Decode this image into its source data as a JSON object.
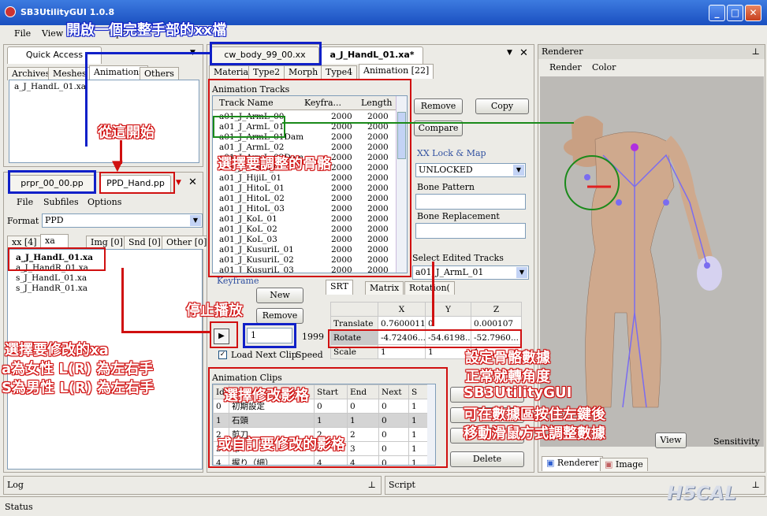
{
  "window": {
    "title": "SB3UtilityGUI 1.0.8",
    "min": "_",
    "max": "□",
    "close": "✕"
  },
  "menu": {
    "file": "File",
    "view": "View",
    "options": "Opti"
  },
  "quick": {
    "label": "Quick Access",
    "tabs": [
      "Archives",
      "Meshes",
      "Animations",
      "Others"
    ],
    "items": [
      "a_J_HandL_01.xa"
    ]
  },
  "pp": {
    "tabs": [
      "prpr_00_00.pp",
      "PPD_Hand.pp"
    ],
    "menu": [
      "File",
      "Subfiles",
      "Options"
    ],
    "format_label": "Format",
    "format_value": "PPD",
    "subtabs": [
      "xx [4]",
      "xa",
      "Img [0]",
      "Snd [0]",
      "Other [0]"
    ],
    "files": [
      "a_J_HandL_01.xa",
      "a_J_HandR_01.xa",
      "s_J_HandL_01.xa",
      "s_J_HandR_01.xa"
    ]
  },
  "editor": {
    "doctabs": [
      "cw_body_99_00.xx",
      "a_J_HandL_01.xa*"
    ],
    "subtabs": [
      "Material",
      "Type2",
      "Morph",
      "Type4",
      "Animation [22]"
    ]
  },
  "tracks": {
    "title": "Animation Tracks",
    "cols": [
      "Track Name",
      "Keyfra...",
      "Length"
    ],
    "rows": [
      [
        "a01_J_ArmL_00",
        "2000",
        "2000"
      ],
      [
        "a01_J_ArmL_01",
        "2000",
        "2000"
      ],
      [
        "a01_J_ArmL_01Dam",
        "2000",
        "2000"
      ],
      [
        "a01_J_ArmL_02",
        "2000",
        "2000"
      ],
      [
        "a01_J_ArmL_02Dam",
        "2000",
        "2000"
      ],
      [
        "a01_J_ArmL_02",
        "2000",
        "2000"
      ],
      [
        "a01_J_HijiL_01",
        "2000",
        "2000"
      ],
      [
        "a01_J_HitoL_01",
        "2000",
        "2000"
      ],
      [
        "a01_J_HitoL_02",
        "2000",
        "2000"
      ],
      [
        "a01_J_HitoL_03",
        "2000",
        "2000"
      ],
      [
        "a01_J_KoL_01",
        "2000",
        "2000"
      ],
      [
        "a01_J_KoL_02",
        "2000",
        "2000"
      ],
      [
        "a01_J_KoL_03",
        "2000",
        "2000"
      ],
      [
        "a01_J_KusuriL_01",
        "2000",
        "2000"
      ],
      [
        "a01_J_KusuriL_02",
        "2000",
        "2000"
      ],
      [
        "a01_J_KusuriL_03",
        "2000",
        "2000"
      ]
    ]
  },
  "right": {
    "remove": "Remove",
    "copy": "Copy",
    "compare": "Compare",
    "lock_title": "XX Lock & Map",
    "lock_value": "UNLOCKED",
    "bone_pattern": "Bone Pattern",
    "bone_replacement": "Bone Replacement",
    "select_edited": "Select Edited Tracks",
    "edited_value": "a01_J_ArmL_01"
  },
  "keyframe": {
    "title": "Keyframe",
    "new": "New",
    "remove": "Remove",
    "frame": "1",
    "end": "1999",
    "load_next": "Load Next Clip",
    "speed": "Speed"
  },
  "srt": {
    "tabs": [
      "SRT",
      "Matrix",
      "Rotation("
    ],
    "cols": [
      "",
      "X",
      "Y",
      "Z"
    ],
    "rows": [
      [
        "Translate",
        "0.7600011",
        "0",
        "0.000107"
      ],
      [
        "Rotate",
        "-4.72406...",
        "-54.6198...",
        "-52.7960..."
      ],
      [
        "Scale",
        "1",
        "1",
        "1"
      ]
    ]
  },
  "clips": {
    "title": "Animation Clips",
    "cols": [
      "Id",
      "Name",
      "Start",
      "End",
      "Next",
      "S"
    ],
    "rows": [
      [
        "0",
        "初期設定",
        "0",
        "0",
        "0",
        "1"
      ],
      [
        "1",
        "石頭",
        "1",
        "1",
        "0",
        "1"
      ],
      [
        "2",
        "剪刀",
        "2",
        "2",
        "0",
        "1"
      ],
      [
        "3",
        "布",
        "3",
        "3",
        "0",
        "1"
      ],
      [
        "4",
        "握り（細）",
        "4",
        "4",
        "0",
        "1"
      ]
    ],
    "delete": "Delete"
  },
  "renderer": {
    "title": "Renderer",
    "menu": [
      "Render",
      "Color"
    ],
    "tabs": [
      "Renderer",
      "Image"
    ],
    "view": "View",
    "sensitivity": "Sensitivity"
  },
  "bottom": {
    "log": "Log",
    "script": "Script",
    "status": "Status"
  },
  "annotations": {
    "open": "開啟一個完整手部的xx檔",
    "start": "從這開始",
    "select_bone": "選擇要調整的骨骼",
    "stop": "停止播放",
    "select_xa": "選擇要修改的xa",
    "female": "a為女性 L(R) 為左右手",
    "male": "S為男性 L(R) 為左右手",
    "select_frame": "選擇修改影格",
    "custom_frame": "或自訂要修改的影格",
    "bone1": "設定骨骼數據",
    "bone2": "正常就轉角度",
    "bone3": "SB3UtilityGUI",
    "bone4": "可在數據區按住左鍵後",
    "bone5": "移動滑鼠方式調整數據"
  },
  "watermark": "H5CAL"
}
